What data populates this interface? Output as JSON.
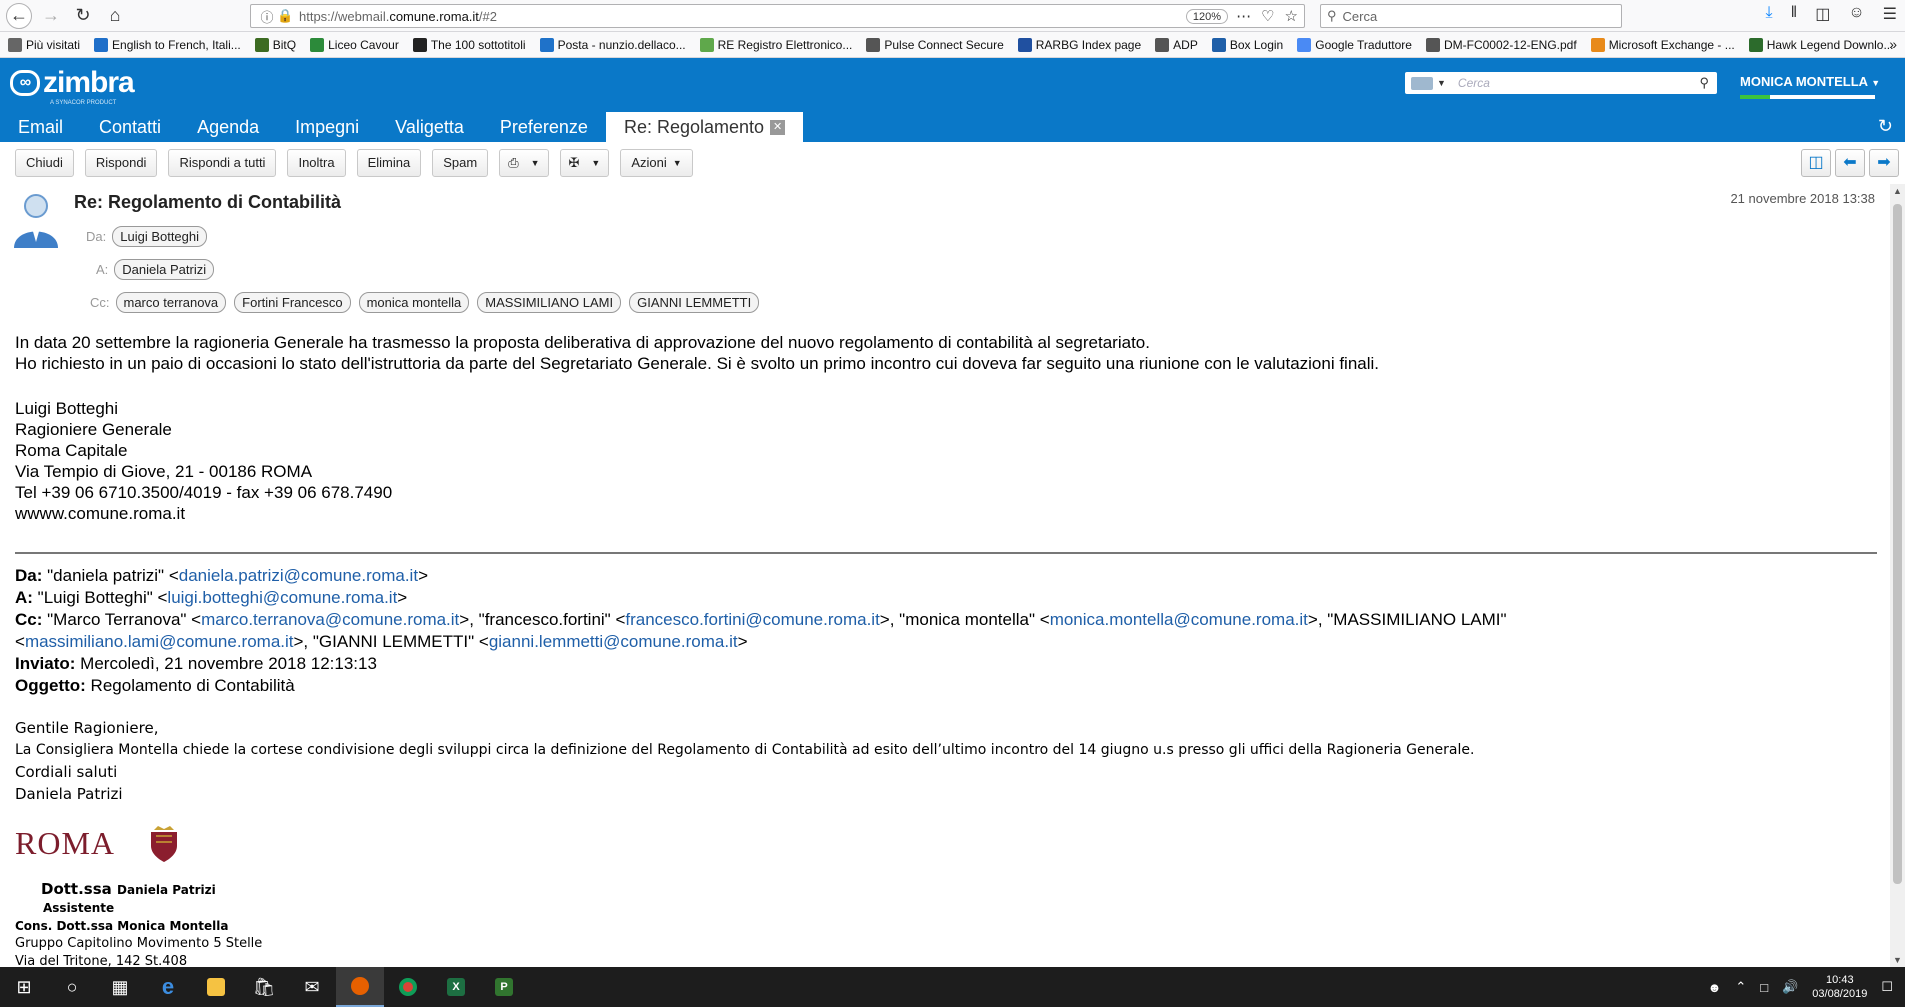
{
  "browser": {
    "url_prefix": "https://webmail.",
    "url_domain": "comune.roma.it",
    "url_suffix": "/#2",
    "zoom": "120%",
    "search_placeholder": "Cerca"
  },
  "bookmarks": [
    {
      "label": "Più visitati",
      "icon": "gear-icon",
      "color": "#666666"
    },
    {
      "label": "English to French, Itali...",
      "icon": "wr-icon",
      "color": "#1f6fc9"
    },
    {
      "label": "BitQ",
      "icon": "bitq-icon",
      "color": "#3d6b22"
    },
    {
      "label": "Liceo Cavour",
      "icon": "liceo-icon",
      "color": "#2c8a3a"
    },
    {
      "label": "The 100 sottotitoli",
      "icon": "tv-icon",
      "color": "#222222"
    },
    {
      "label": "Posta - nunzio.dellaco...",
      "icon": "outlook-icon",
      "color": "#1f72c9"
    },
    {
      "label": "RE Registro Elettronico...",
      "icon": "re-icon",
      "color": "#5fa84b"
    },
    {
      "label": "Pulse Connect Secure",
      "icon": "globe-icon",
      "color": "#555555"
    },
    {
      "label": "RARBG Index page",
      "icon": "rarbg-icon",
      "color": "#2050a0"
    },
    {
      "label": "ADP",
      "icon": "globe-icon",
      "color": "#555555"
    },
    {
      "label": "Box Login",
      "icon": "box-icon",
      "color": "#1f5fa8"
    },
    {
      "label": "Google Traduttore",
      "icon": "translate-icon",
      "color": "#4a8af4"
    },
    {
      "label": "DM-FC0002-12-ENG.pdf",
      "icon": "globe-icon",
      "color": "#555555"
    },
    {
      "label": "Microsoft Exchange - ...",
      "icon": "exchange-icon",
      "color": "#e88a1a"
    },
    {
      "label": "Hawk Legend Downlo...",
      "icon": "hawk-icon",
      "color": "#2c6b2c"
    }
  ],
  "zimbra": {
    "logo": "zimbra",
    "logo_sub": "A SYNACOR PRODUCT",
    "search_placeholder": "Cerca",
    "user": "MONICA MONTELLA",
    "tabs": [
      "Email",
      "Contatti",
      "Agenda",
      "Impegni",
      "Valigetta",
      "Preferenze"
    ],
    "active_tab": "Re: Regolamento"
  },
  "actions": {
    "close": "Chiudi",
    "reply": "Rispondi",
    "reply_all": "Rispondi a tutti",
    "forward": "Inoltra",
    "delete": "Elimina",
    "spam": "Spam",
    "actions": "Azioni"
  },
  "message": {
    "subject": "Re: Regolamento di Contabilità",
    "date": "21 novembre 2018 13:38",
    "from_label": "Da:",
    "to_label": "A:",
    "cc_label": "Cc:",
    "from": "Luigi Botteghi",
    "to": "Daniela Patrizi",
    "cc": [
      "marco terranova",
      "Fortini Francesco",
      "monica montella",
      "MASSIMILIANO LAMI",
      "GIANNI LEMMETTI"
    ],
    "body": [
      "In data 20 settembre la ragioneria Generale ha trasmesso la proposta deliberativa di approvazione del nuovo regolamento di contabilità al segretariato.",
      "Ho richiesto in un paio di occasioni lo stato dell'istruttoria da parte del Segretariato Generale. Si è svolto un primo incontro cui doveva far seguito una riunione con le valutazioni finali."
    ],
    "signature": [
      "Luigi Botteghi",
      "Ragioniere Generale",
      "Roma Capitale",
      "Via Tempio di Giove, 21 - 00186 ROMA",
      "Tel +39 06 6710.3500/4019 - fax +39 06 678.7490",
      "wwww.comune.roma.it"
    ]
  },
  "quoted": {
    "da_label": "Da:",
    "da_name": " \"daniela patrizi\" <",
    "da_email": "daniela.patrizi@comune.roma.it",
    "a_label": "A:",
    "a_name": " \"Luigi Botteghi\" <",
    "a_email": "luigi.botteghi@comune.roma.it",
    "cc_label": "Cc:",
    "cc1_name": " \"Marco Terranova\" <",
    "cc1_email": "marco.terranova@comune.roma.it",
    "cc2_name": ">, \"francesco.fortini\" <",
    "cc2_email": "francesco.fortini@comune.roma.it",
    "cc3_name": ">, \"monica montella\" <",
    "cc3_email": "monica.montella@comune.roma.it",
    "cc4_name": ">, \"MASSIMILIANO LAMI\"",
    "cc4_open": "<",
    "cc4_email": "massimiliano.lami@comune.roma.it",
    "cc5_name": ">, \"GIANNI LEMMETTI\" <",
    "cc5_email": "gianni.lemmetti@comune.roma.it",
    "close": ">",
    "sent_label": "Inviato:",
    "sent": " Mercoledì, 21 novembre 2018 12:13:13",
    "subject_label": "Oggetto:",
    "subject": " Regolamento di Contabilità",
    "body": [
      "Gentile Ragioniere,",
      "La Consigliera Montella chiede la cortese condivisione degli sviluppi circa la definizione del Regolamento di Contabilità ad esito dell’ultimo incontro  del 14 giugno u.s presso gli uffici della Ragioneria Generale.",
      "Cordiali saluti",
      "Daniela Patrizi"
    ],
    "roma_logo": "ROMA",
    "sig_title": "Dott.ssa",
    "sig_name": "Daniela Patrizi",
    "sig_role": "Assistente",
    "sig_cons": "Cons. Dott.ssa Monica Montella",
    "sig_group": "Gruppo Capitolino Movimento 5 Stelle",
    "sig_addr": "Via del Tritone, 142 St.408"
  },
  "taskbar": {
    "time": "10:43",
    "date": "03/08/2019"
  }
}
